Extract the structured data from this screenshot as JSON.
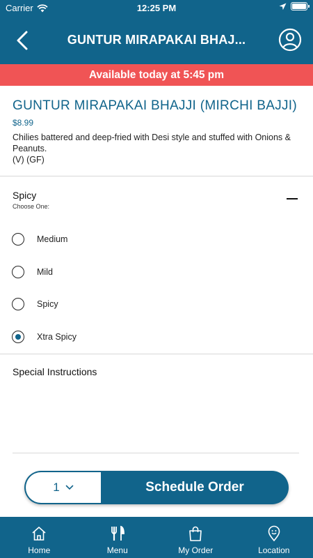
{
  "status_bar": {
    "carrier": "Carrier",
    "time": "12:25 PM"
  },
  "header": {
    "title": "GUNTUR MIRAPAKAI BHAJ...",
    "back_icon": "chevron-left-icon",
    "profile_icon": "user-circle-icon"
  },
  "availability": "Available today at 5:45 pm",
  "item": {
    "name": "GUNTUR MIRAPAKAI BHAJJI (MIRCHI BAJJI)",
    "price": "$8.99",
    "description": "Chilies battered and deep-fried with Desi style and stuffed with Onions & Peanuts.",
    "tags": "(V) (GF)"
  },
  "spicy": {
    "title": "Spicy",
    "subtitle": "Choose One:",
    "options": [
      {
        "label": "Medium",
        "selected": false
      },
      {
        "label": "Mild",
        "selected": false
      },
      {
        "label": "Spicy",
        "selected": false
      },
      {
        "label": "Xtra Spicy",
        "selected": true
      }
    ]
  },
  "special_instructions": {
    "title": "Special Instructions"
  },
  "order": {
    "quantity": "1",
    "button_label": "Schedule Order"
  },
  "tabs": [
    {
      "label": "Home",
      "icon": "home-icon"
    },
    {
      "label": "Menu",
      "icon": "fork-knife-icon"
    },
    {
      "label": "My Order",
      "icon": "shopping-bag-icon"
    },
    {
      "label": "Location",
      "icon": "location-pin-icon"
    }
  ],
  "colors": {
    "primary": "#11648b",
    "banner": "#f05455"
  }
}
